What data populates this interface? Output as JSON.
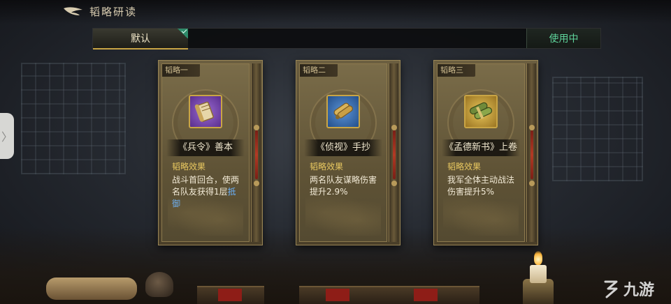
{
  "header": {
    "title": "韬略研读"
  },
  "tabs": {
    "default_label": "默认",
    "in_use_label": "使用中"
  },
  "side_handle": {
    "glyph": "〉"
  },
  "cards": [
    {
      "tag": "韬略一",
      "icon": "purple-scroll-icon",
      "icon_bg": "#6b3fa0",
      "name": "《兵令》善本",
      "effect_label": "韬略效果",
      "effect_text": "战斗首回合，使两名队友获得1层",
      "effect_keyword": "抵御"
    },
    {
      "tag": "韬略二",
      "icon": "blue-scroll-icon",
      "icon_bg": "#2f63a8",
      "name": "《侦视》手抄",
      "effect_label": "韬略效果",
      "effect_text": "两名队友谋略伤害提升2.9%",
      "effect_keyword": ""
    },
    {
      "tag": "韬略三",
      "icon": "gold-scroll-icon",
      "icon_bg": "#b08a2a",
      "name": "《孟德新书》上卷",
      "effect_label": "韬略效果",
      "effect_text": "我军全体主动战法伤害提升5%",
      "effect_keyword": ""
    }
  ],
  "watermark": {
    "text": "九游"
  }
}
